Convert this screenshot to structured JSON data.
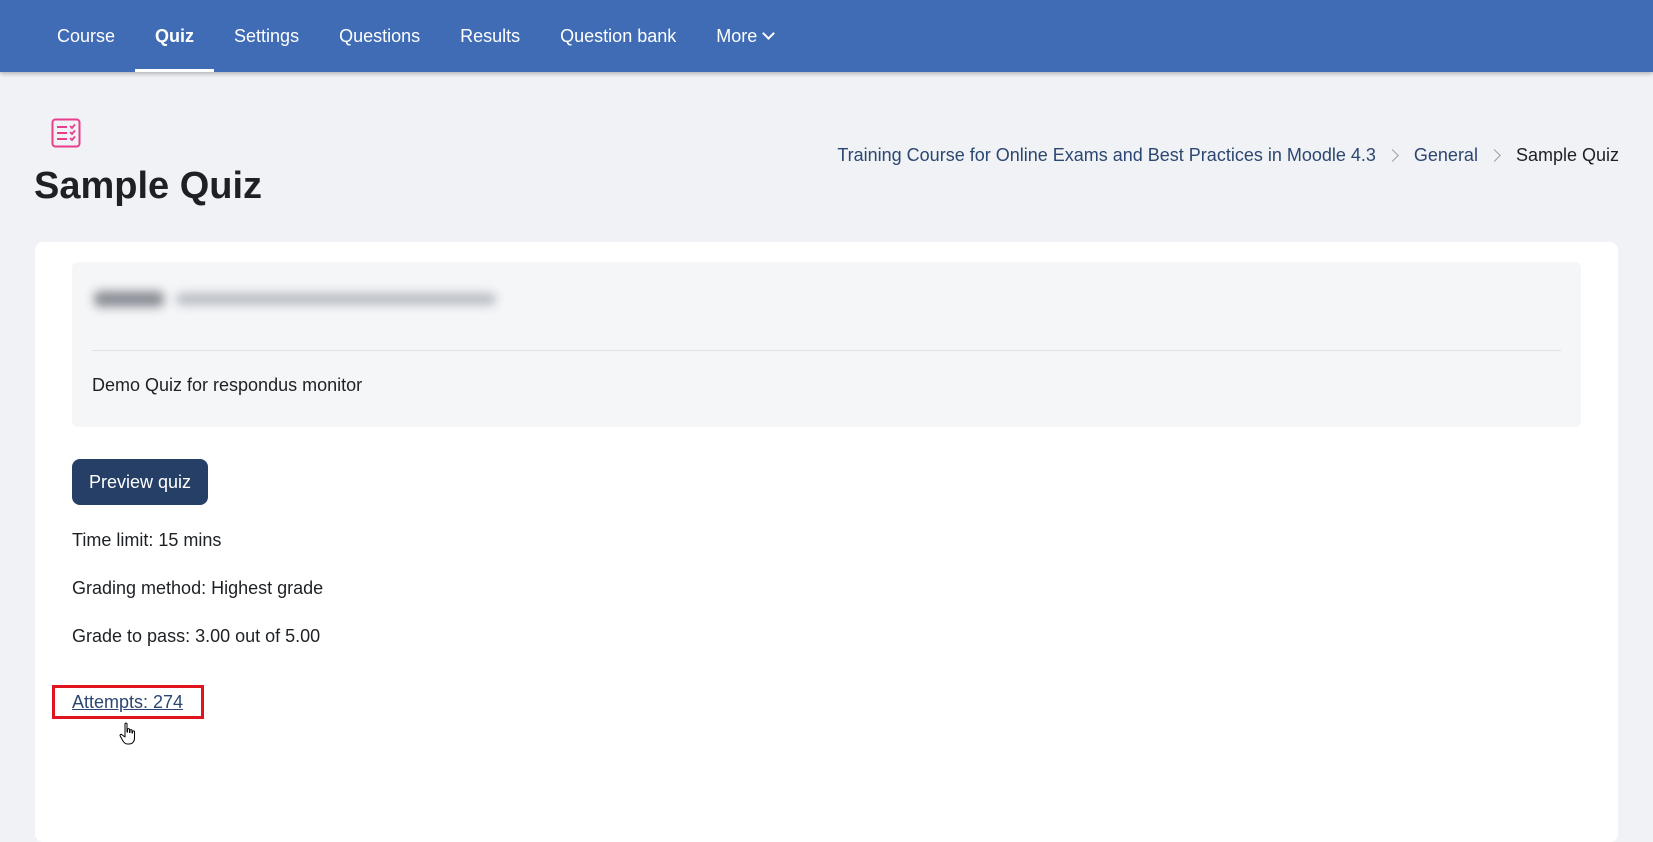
{
  "nav": {
    "items": [
      {
        "label": "Course",
        "active": false
      },
      {
        "label": "Quiz",
        "active": true
      },
      {
        "label": "Settings",
        "active": false
      },
      {
        "label": "Questions",
        "active": false
      },
      {
        "label": "Results",
        "active": false
      },
      {
        "label": "Question bank",
        "active": false
      },
      {
        "label": "More",
        "active": false
      }
    ],
    "background_color": "#3f6cb5"
  },
  "header": {
    "title": "Sample Quiz",
    "icon": "quiz-icon",
    "icon_color": "#e83e8c"
  },
  "breadcrumb": {
    "items": [
      "Training Course for Online Exams and Best Practices in Moodle 4.3",
      "General",
      "Sample Quiz"
    ]
  },
  "content": {
    "description": "Demo Quiz for respondus monitor",
    "preview_button_label": "Preview quiz",
    "time_limit": "Time limit: 15 mins",
    "grading_method": "Grading method: Highest grade",
    "grade_to_pass": "Grade to pass: 3.00 out of 5.00",
    "attempts_link": "Attempts: 274"
  },
  "colors": {
    "highlight_border": "#e0141e",
    "button_bg": "#253f66",
    "link": "#2b4771"
  }
}
